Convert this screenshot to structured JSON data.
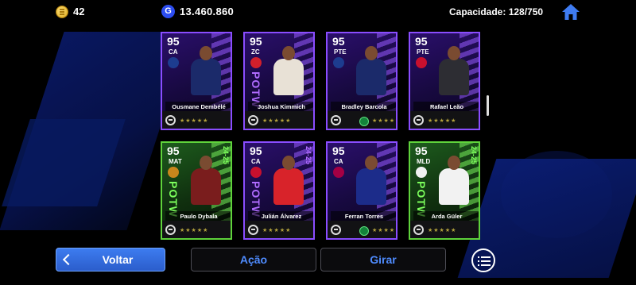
{
  "topbar": {
    "coins": "42",
    "gp": "13.460.860",
    "gp_icon_letter": "G",
    "capacity": "Capacidade: 128/750"
  },
  "cards": [
    {
      "ovr": "95",
      "pos": "CA",
      "name": "Ousmane Dembélé",
      "theme": "purple",
      "potw": "",
      "season": "",
      "crest_color": "#1d3c8f",
      "kit_color": "#1b2a6a",
      "skill": false
    },
    {
      "ovr": "95",
      "pos": "ZC",
      "name": "Joshua Kimmich",
      "theme": "purple",
      "potw": "POTW",
      "season": "",
      "crest_color": "#d21f2b",
      "kit_color": "#e8e1d6",
      "skill": false
    },
    {
      "ovr": "95",
      "pos": "PTE",
      "name": "Bradley Barcola",
      "theme": "purple",
      "potw": "",
      "season": "",
      "crest_color": "#1d3c8f",
      "kit_color": "#1b2a6a",
      "skill": true
    },
    {
      "ovr": "95",
      "pos": "PTE",
      "name": "Rafael Leão",
      "theme": "purple",
      "potw": "",
      "season": "",
      "crest_color": "#c8102e",
      "kit_color": "#2d2d33",
      "skill": false
    },
    {
      "ovr": "95",
      "pos": "MAT",
      "name": "Paulo Dybala",
      "theme": "green",
      "potw": "POTW",
      "season": "24-25",
      "crest_color": "#c8861c",
      "kit_color": "#7a1d1d",
      "skill": false
    },
    {
      "ovr": "95",
      "pos": "CA",
      "name": "Julián Álvarez",
      "theme": "purple",
      "potw": "POTW",
      "season": "24-25",
      "crest_color": "#c8102e",
      "kit_color": "#d8232a",
      "skill": false
    },
    {
      "ovr": "95",
      "pos": "CA",
      "name": "Ferran Torres",
      "theme": "purple",
      "potw": "",
      "season": "",
      "crest_color": "#a50044",
      "kit_color": "#1c2c8a",
      "skill": true
    },
    {
      "ovr": "95",
      "pos": "MLD",
      "name": "Arda Güler",
      "theme": "green",
      "potw": "POTW",
      "season": "24-25",
      "crest_color": "#f0f0f0",
      "kit_color": "#f2f2f2",
      "skill": false
    }
  ],
  "stars": "★★★★★",
  "buttons": {
    "back": "Voltar",
    "action": "Ação",
    "turn": "Girar"
  }
}
